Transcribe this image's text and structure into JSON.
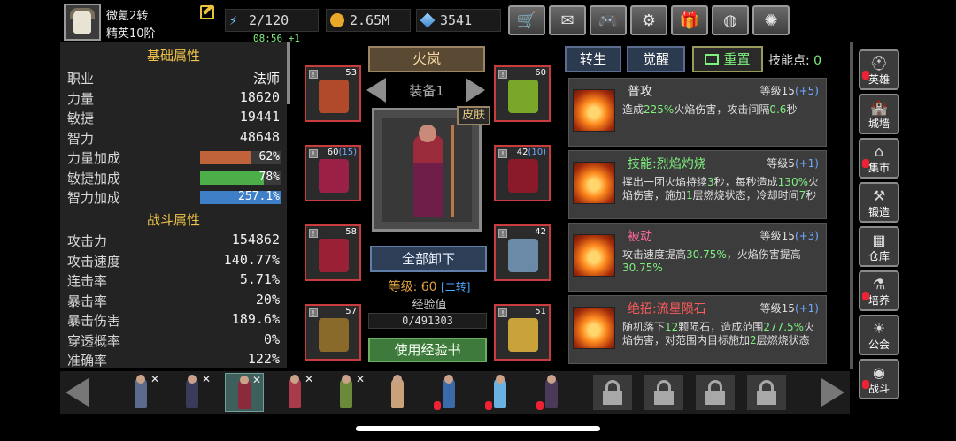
{
  "player": {
    "name": "微氪2转",
    "rank": "精英10阶",
    "stamina": "2/120",
    "regen_timer": "08:56 +1",
    "gold": "2.65M",
    "gems": "3541"
  },
  "topbar_buttons": [
    {
      "name": "shop",
      "icon": "cart-icon",
      "glyph": "🛒"
    },
    {
      "name": "mail",
      "icon": "mail-icon",
      "glyph": "✉"
    },
    {
      "name": "gamepad",
      "icon": "gamepad-icon",
      "glyph": "🎮"
    },
    {
      "name": "settings",
      "icon": "gear-icon",
      "glyph": "⚙"
    },
    {
      "name": "gift",
      "icon": "gift-icon",
      "glyph": "🎁"
    },
    {
      "name": "wheel",
      "icon": "color-wheel-icon",
      "glyph": "◍"
    },
    {
      "name": "fireworks",
      "icon": "firework-icon",
      "glyph": "✺"
    }
  ],
  "basic_stats": {
    "title": "基础属性",
    "rows": [
      {
        "k": "职业",
        "v": "法师"
      },
      {
        "k": "力量",
        "v": "18620"
      },
      {
        "k": "敏捷",
        "v": "19441"
      },
      {
        "k": "智力",
        "v": "48648"
      }
    ],
    "bars": [
      {
        "k": "力量加成",
        "v": "62%",
        "fill": 0.62,
        "color": "#c0623a"
      },
      {
        "k": "敏捷加成",
        "v": "78%",
        "fill": 0.78,
        "color": "#4cae48"
      },
      {
        "k": "智力加成",
        "v": "257.1%",
        "fill": 1.0,
        "color": "#3f7fc8"
      }
    ]
  },
  "combat_stats": {
    "title": "战斗属性",
    "rows": [
      {
        "k": "攻击力",
        "v": "154862"
      },
      {
        "k": "攻击速度",
        "v": "140.77%"
      },
      {
        "k": "连击率",
        "v": "5.71%"
      },
      {
        "k": "暴击率",
        "v": "20%"
      },
      {
        "k": "暴击伤害",
        "v": "189.6%"
      },
      {
        "k": "穿透概率",
        "v": "0%"
      },
      {
        "k": "准确率",
        "v": "122%"
      }
    ]
  },
  "hero": {
    "name": "火岚",
    "equip_set": "装备1",
    "skin_label": "皮肤",
    "unequip_all": "全部卸下",
    "level_label": "等级: 60",
    "transfer": "[二转]",
    "exp_label": "经验值",
    "exp_value": "0/491303",
    "use_book": "使用经验书"
  },
  "equipment": [
    {
      "slot": "chest",
      "level": "53",
      "plus": "",
      "color": "#b04a2a"
    },
    {
      "slot": "amulet",
      "level": "60",
      "plus": "",
      "color": "#7aa62a"
    },
    {
      "slot": "gloves",
      "level": "60",
      "plus": "(15)",
      "color": "#9a2046"
    },
    {
      "slot": "gauntlets",
      "level": "42",
      "plus": "(10)",
      "color": "#8a1a2a"
    },
    {
      "slot": "legs",
      "level": "58",
      "plus": "",
      "color": "#9a2036"
    },
    {
      "slot": "blade",
      "level": "42",
      "plus": "",
      "color": "#6a8aa8"
    },
    {
      "slot": "boots",
      "level": "57",
      "plus": "",
      "color": "#8a6a2a"
    },
    {
      "slot": "staff",
      "level": "51",
      "plus": "",
      "color": "#c9a23a"
    }
  ],
  "skills_panel": {
    "tab_transfer": "转生",
    "tab_awaken": "觉醒",
    "tab_reset": "重置",
    "points_label": "技能点:",
    "points_value": "0",
    "skills": [
      {
        "name": "普攻",
        "name_color": "#e8e8e8",
        "level": "等级15",
        "bonus": "(+5)",
        "desc": "造成<span class='hl-g'>225%</span>火焰伤害，攻击间隔<span class='hl-g'>0.6</span>秒"
      },
      {
        "name": "技能:烈焰灼烧",
        "name_color": "#7ef07e",
        "level": "等级5",
        "bonus": "(+1)",
        "desc": "挥出一团火焰持续<span class='hl-g'>3</span>秒，每秒造成<span class='hl-g'>130%</span>火焰伤害，施加<span class='hl-g'>1</span>层燃烧状态，冷却时间<span class='hl-g'>7</span>秒"
      },
      {
        "name": "被动",
        "name_color": "#ff6a9a",
        "level": "等级15",
        "bonus": "(+3)",
        "desc": "攻击速度提高<span class='hl-g'>30.75%</span>，火焰伤害提高<span class='hl-g'>30.75%</span>"
      },
      {
        "name": "绝招:流星陨石",
        "name_color": "#ff5a5a",
        "level": "等级15",
        "bonus": "(+1)",
        "desc": "随机落下<span class='hl-g'>12</span>颗陨石，造成范围<span class='hl-g'>277.5%</span>火焰伤害，对范围内目标施加<span class='hl-g'>2</span>层燃烧状态"
      }
    ]
  },
  "side_nav": [
    {
      "label": "英雄",
      "icon": "hero-helmet-icon",
      "glyph": "⛑",
      "alert": true
    },
    {
      "label": "城墙",
      "icon": "castle-wall-icon",
      "glyph": "🏰",
      "alert": false
    },
    {
      "label": "集市",
      "icon": "market-icon",
      "glyph": "⌂",
      "alert": true
    },
    {
      "label": "锻造",
      "icon": "anvil-hammer-icon",
      "glyph": "⚒",
      "alert": false
    },
    {
      "label": "仓库",
      "icon": "warehouse-icon",
      "glyph": "▦",
      "alert": false
    },
    {
      "label": "培养",
      "icon": "cultivate-icon",
      "glyph": "⚗",
      "alert": true
    },
    {
      "label": "公会",
      "icon": "guild-icon",
      "glyph": "☀",
      "alert": false
    },
    {
      "label": "战斗",
      "icon": "battle-portal-icon",
      "glyph": "◉",
      "alert": true
    }
  ],
  "hero_roster": [
    {
      "color": "#5a6a8a",
      "crossed": true,
      "alert": false,
      "selected": false
    },
    {
      "color": "#3a3a5a",
      "crossed": true,
      "alert": false,
      "selected": false
    },
    {
      "color": "#8a2a3a",
      "crossed": true,
      "alert": false,
      "selected": true
    },
    {
      "color": "#a83a4a",
      "crossed": true,
      "alert": false,
      "selected": false
    },
    {
      "color": "#6a8a3a",
      "crossed": true,
      "alert": false,
      "selected": false
    },
    {
      "color": "#c9a27a",
      "crossed": false,
      "alert": false,
      "selected": false
    },
    {
      "color": "#3a6aa8",
      "crossed": false,
      "alert": true,
      "selected": false
    },
    {
      "color": "#6ab0e0",
      "crossed": false,
      "alert": true,
      "selected": false
    },
    {
      "color": "#4a3a5a",
      "crossed": false,
      "alert": true,
      "selected": false
    }
  ],
  "locked_slots": 4
}
